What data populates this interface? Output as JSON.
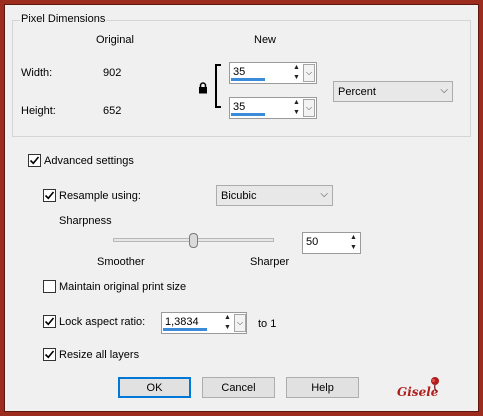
{
  "pixel_dimensions": {
    "group_title": "Pixel Dimensions",
    "col_original": "Original",
    "col_new": "New",
    "width_label": "Width:",
    "width_original": "902",
    "width_new": "35",
    "height_label": "Height:",
    "height_original": "652",
    "height_new": "35",
    "unit": "Percent"
  },
  "advanced": {
    "label": "Advanced settings",
    "checked": true
  },
  "resample": {
    "label": "Resample using:",
    "checked": true,
    "method": "Bicubic"
  },
  "sharpness": {
    "label": "Sharpness",
    "left_label": "Smoother",
    "right_label": "Sharper",
    "value": "50",
    "level": 0.5
  },
  "maintain_print": {
    "label": "Maintain original print size",
    "checked": false
  },
  "lock_aspect": {
    "label": "Lock aspect ratio:",
    "checked": true,
    "value": "1,3834",
    "suffix": "to 1"
  },
  "resize_layers": {
    "label": "Resize all layers",
    "checked": true
  },
  "buttons": {
    "ok": "OK",
    "cancel": "Cancel",
    "help": "Help"
  },
  "watermark": "Gisele",
  "colors": {
    "frame": "#9b2c1e",
    "accent": "#3b8bd9",
    "default_button_border": "#0078d7",
    "watermark": "#b01e1e"
  }
}
